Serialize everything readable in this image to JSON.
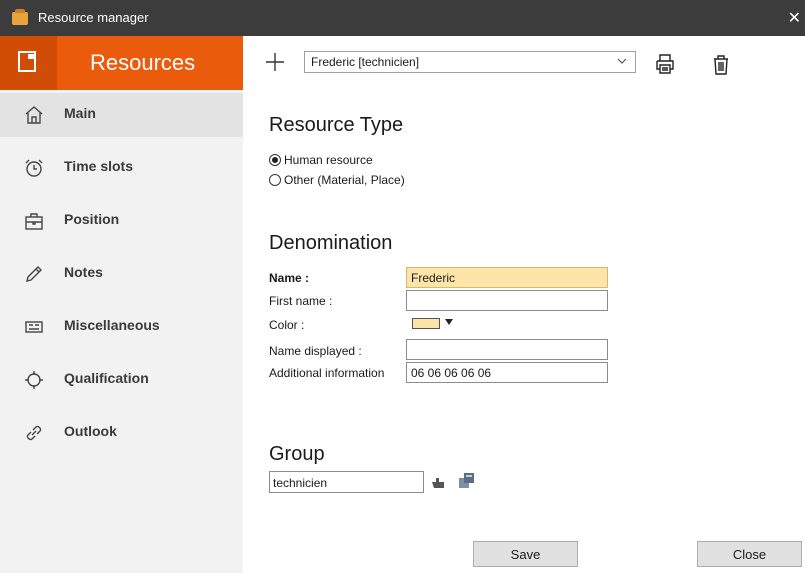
{
  "window": {
    "title": "Resource manager",
    "close_glyph": "✕"
  },
  "sidebar": {
    "header": {
      "label": "Resources",
      "icon": "resources-icon"
    },
    "items": [
      {
        "label": "Main",
        "icon": "home-icon",
        "active": true
      },
      {
        "label": "Time slots",
        "icon": "alarm-clock-icon"
      },
      {
        "label": "Position",
        "icon": "briefcase-icon"
      },
      {
        "label": "Notes",
        "icon": "pencil-icon"
      },
      {
        "label": "Miscellaneous",
        "icon": "keyboard-icon"
      },
      {
        "label": "Qualification",
        "icon": "crosshair-icon"
      },
      {
        "label": "Outlook",
        "icon": "link-icon"
      }
    ]
  },
  "toolbar": {
    "add_icon": "plus-icon",
    "selected_resource": "Frederic  [technicien]",
    "print_icon": "printer-icon",
    "delete_icon": "trash-icon"
  },
  "resource_type": {
    "title": "Resource Type",
    "options": [
      {
        "label": "Human resource",
        "checked": true
      },
      {
        "label": "Other (Material, Place)",
        "checked": false
      }
    ]
  },
  "denomination": {
    "title": "Denomination",
    "name_label": "Name :",
    "name_value": "Frederic",
    "first_name_label": "First name :",
    "first_name_value": "",
    "color_label": "Color :",
    "color_value": "#fde4a8",
    "name_displayed_label": "Name displayed :",
    "name_displayed_value": "",
    "additional_label": "Additional information",
    "additional_value": "06 06 06 06 06"
  },
  "group": {
    "title": "Group",
    "value": "technicien",
    "hand_icon": "hand-pointer-icon",
    "copy_icon": "copy-windows-icon"
  },
  "buttons": {
    "save": "Save",
    "close": "Close"
  },
  "colors": {
    "accent": "#ea5b0c",
    "accent_dark": "#d14d05",
    "titlebar": "#3c3c3c",
    "highlight": "#fde4a8"
  }
}
